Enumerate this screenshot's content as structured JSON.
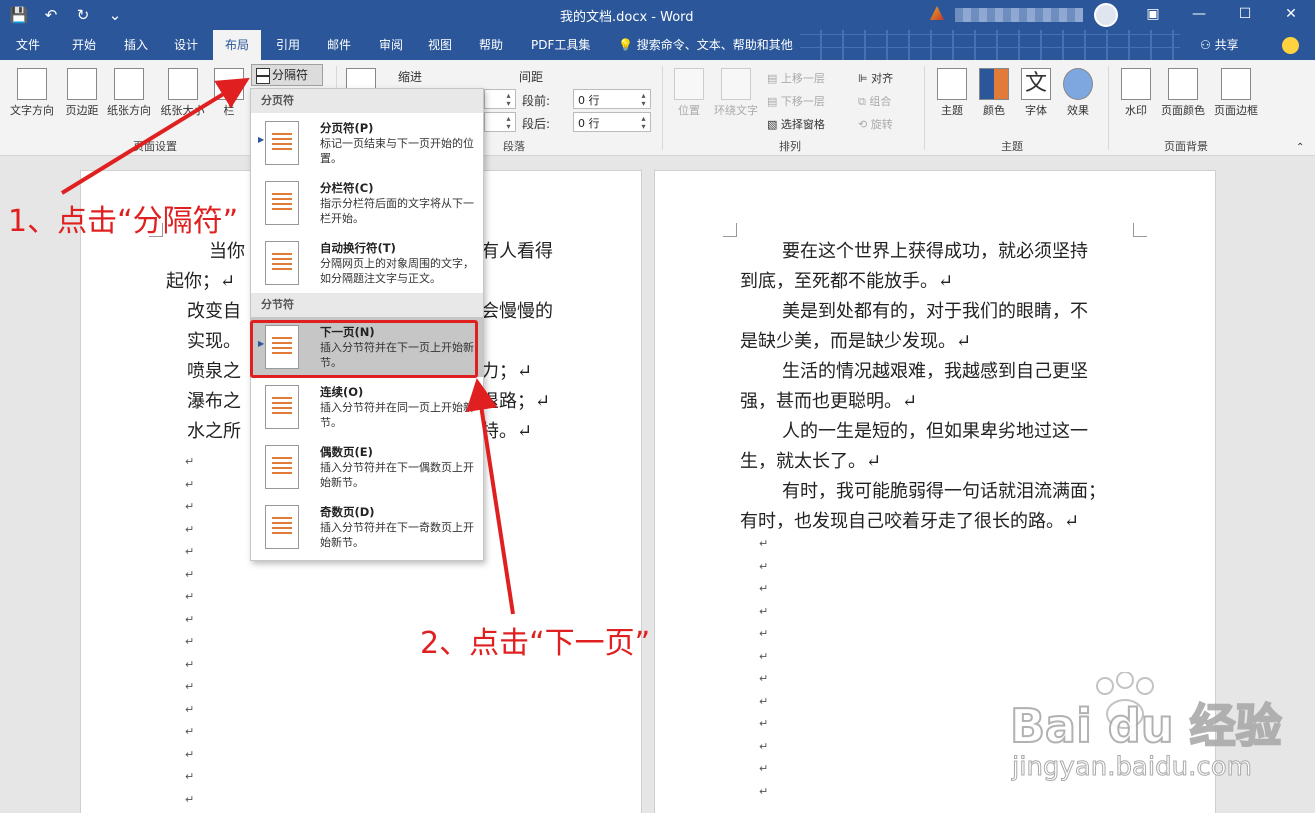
{
  "titlebar": {
    "title": "我的文档.docx  -  Word",
    "qat": [
      "💾",
      "↶",
      "↻",
      "⌄"
    ],
    "window_buttons": [
      "▣",
      "—",
      "☐",
      "✕"
    ]
  },
  "tabs": [
    "文件",
    "开始",
    "插入",
    "设计",
    "布局",
    "引用",
    "邮件",
    "审阅",
    "视图",
    "帮助",
    "PDF工具集"
  ],
  "active_tab": "布局",
  "search_text": "搜索命令、文本、帮助和其他",
  "share_label": "共享",
  "ribbon": {
    "page_setup": {
      "buttons": [
        "文字方向",
        "页边距",
        "纸张方向",
        "纸张大小",
        "栏"
      ],
      "breaks_button": "分隔符",
      "label": "页面设置"
    },
    "indent_label": "缩进",
    "spacing_label": "间距",
    "spacing_before_label": "段前:",
    "spacing_before_value": "0 行",
    "spacing_after_label": "段后:",
    "spacing_after_value": "0 行",
    "paragraph_label": "段落",
    "arrange": {
      "buttons": [
        "位置",
        "环绕文字"
      ],
      "small": [
        "上移一层",
        "下移一层",
        "选择窗格",
        "对齐",
        "组合",
        "旋转"
      ],
      "label": "排列"
    },
    "theme": {
      "buttons": [
        "主题",
        "颜色",
        "字体",
        "效果"
      ],
      "font_glyph": "文",
      "label": "主题"
    },
    "background": {
      "buttons": [
        "水印",
        "页面颜色",
        "页面边框"
      ],
      "label": "页面背景"
    }
  },
  "menu": {
    "page_break_header": "分页符",
    "section_break_header": "分节符",
    "items": [
      {
        "title": "分页符(P)",
        "desc": "标记一页结束与下一页开始的位置。"
      },
      {
        "title": "分栏符(C)",
        "desc": "指示分栏符后面的文字将从下一栏开始。"
      },
      {
        "title": "自动换行符(T)",
        "desc": "分隔网页上的对象周围的文字，如分隔题注文字与正文。"
      },
      {
        "title": "下一页(N)",
        "desc": "插入分节符并在下一页上开始新节。"
      },
      {
        "title": "连续(O)",
        "desc": "插入分节符并在同一页上开始新节。"
      },
      {
        "title": "偶数页(E)",
        "desc": "插入分节符并在下一偶数页上开始新节。"
      },
      {
        "title": "奇数页(D)",
        "desc": "插入分节符并在下一奇数页上开始新节。"
      }
    ]
  },
  "left_page": {
    "lines": [
      "当你",
      "有人看得",
      "起你；↵",
      "改变自",
      "会慢慢的",
      "实现。",
      "喷泉之",
      "力；↵",
      "瀑布之",
      "退路；↵",
      "水之所",
      "特。↵"
    ]
  },
  "right_page": {
    "lines": [
      "要在这个世界上获得成功，就必须坚持",
      "到底，至死都不能放手。↵",
      "美是到处都有的，对于我们的眼睛，不",
      "是缺少美，而是缺少发现。↵",
      "生活的情况越艰难，我越感到自己更坚",
      "强，甚而也更聪明。↵",
      "人的一生是短的，但如果卑劣地过这一",
      "生，就太长了。↵",
      "有时，我可能脆弱得一句话就泪流满面；",
      "有时，也发现自己咬着牙走了很长的路。↵"
    ]
  },
  "annotations": {
    "step1": "1、点击“分隔符”",
    "step2": "2、点击“下一页”"
  },
  "watermark": {
    "main": "Bai du 经验",
    "url": "jingyan.baidu.com"
  },
  "colors": {
    "word_blue": "#2b579a",
    "annotation_red": "#e02020",
    "menu_highlight": "#c6c6c6"
  }
}
